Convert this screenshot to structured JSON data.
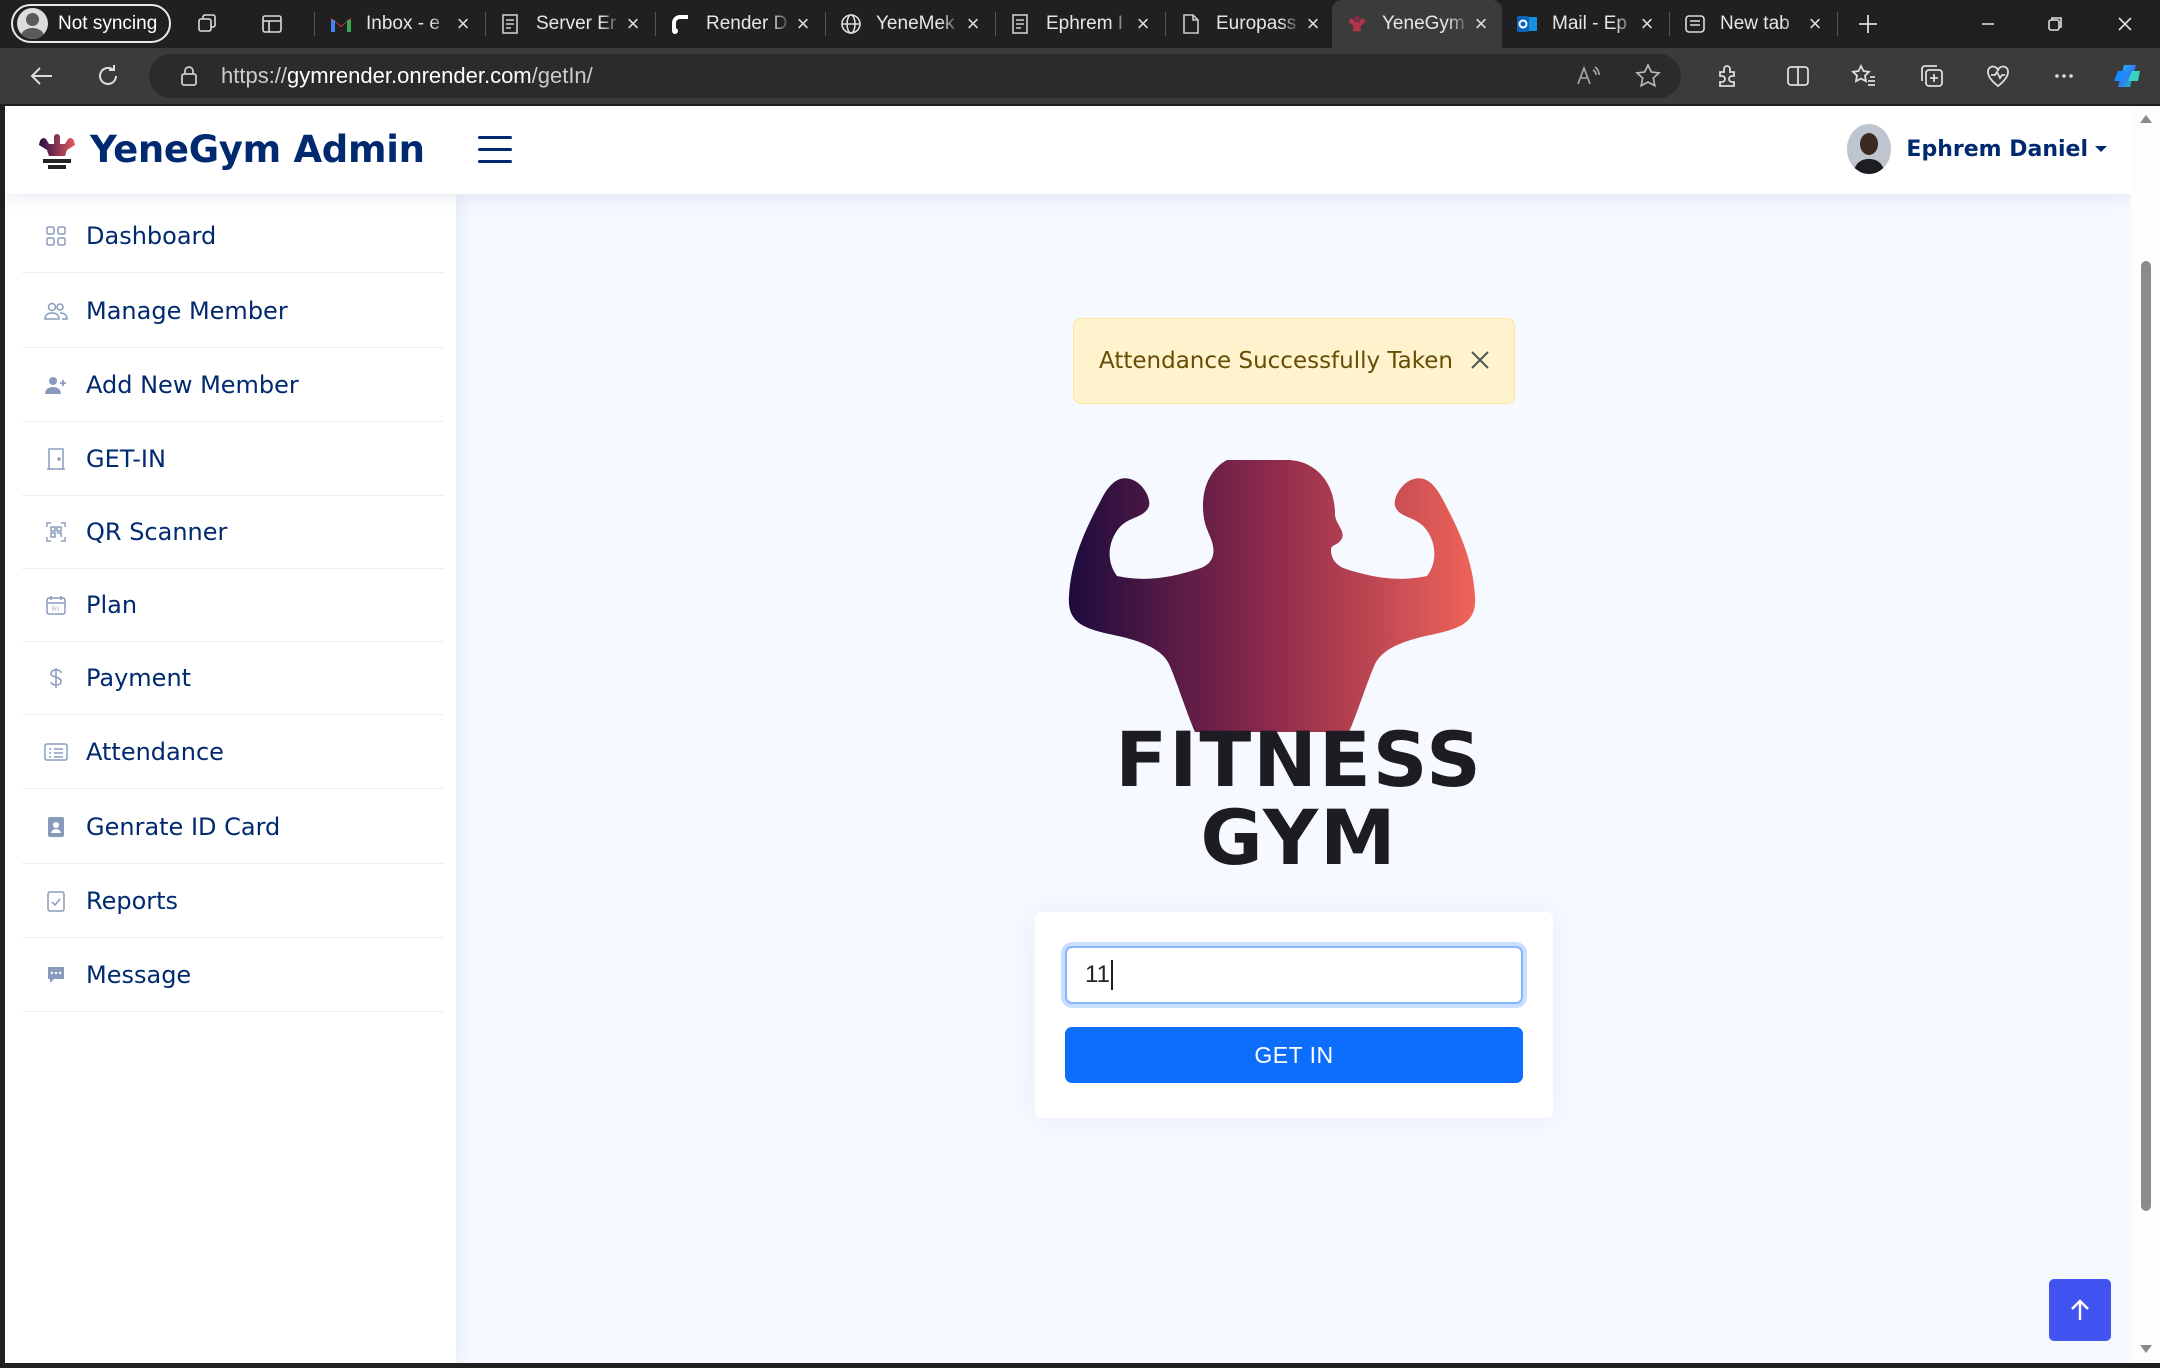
{
  "browser": {
    "profile_label": "Not syncing",
    "tabs": [
      {
        "title": "Inbox - e",
        "icon": "gmail-icon"
      },
      {
        "title": "Server Er",
        "icon": "document-icon"
      },
      {
        "title": "Render D",
        "icon": "render-icon"
      },
      {
        "title": "YeneMek",
        "icon": "globe-icon"
      },
      {
        "title": "Ephrem I",
        "icon": "document-icon"
      },
      {
        "title": "Europass",
        "icon": "page-icon"
      },
      {
        "title": "YeneGym",
        "icon": "gym-icon",
        "active": true
      },
      {
        "title": "Mail - Ep",
        "icon": "outlook-icon"
      },
      {
        "title": "New tab",
        "icon": "newtab-icon"
      }
    ],
    "url_prefix": "https://",
    "url_host": "gymrender.onrender.com",
    "url_path": "/getIn/"
  },
  "header": {
    "brand": "YeneGym Admin",
    "user_name": "Ephrem Daniel"
  },
  "sidebar": {
    "items": [
      {
        "label": "Dashboard",
        "icon": "grid-icon"
      },
      {
        "label": "Manage Member",
        "icon": "people-icon"
      },
      {
        "label": "Add New Member",
        "icon": "person-plus-icon"
      },
      {
        "label": "GET-IN",
        "icon": "door-icon"
      },
      {
        "label": "QR Scanner",
        "icon": "qr-scan-icon"
      },
      {
        "label": "Plan",
        "icon": "calendar-icon"
      },
      {
        "label": "Payment",
        "icon": "dollar-icon"
      },
      {
        "label": "Attendance",
        "icon": "list-card-icon"
      },
      {
        "label": "Genrate ID Card",
        "icon": "id-badge-icon"
      },
      {
        "label": "Reports",
        "icon": "clipboard-check-icon"
      },
      {
        "label": "Message",
        "icon": "chat-icon"
      }
    ]
  },
  "main": {
    "alert_text": "Attendance Successfully Taken",
    "logo_line1": "FITNESS",
    "logo_line2": "GYM",
    "input_value": "11",
    "button_label": "GET IN"
  },
  "colors": {
    "brand_navy": "#012970",
    "primary_button": "#0d6efd",
    "alert_bg": "#fff3cd",
    "back_to_top": "#4154f1"
  }
}
